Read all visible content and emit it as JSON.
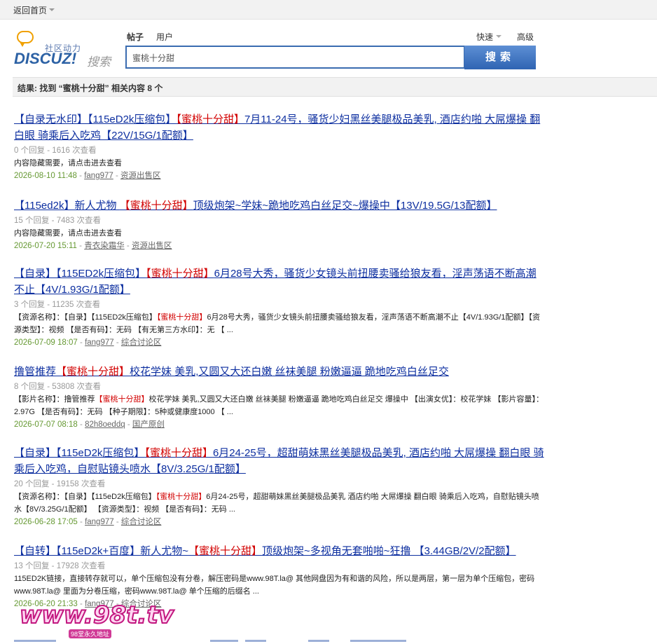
{
  "topbar": {
    "home_label": "返回首页"
  },
  "logo": {
    "slogan": "社区动力",
    "brand": "DISCUZ!",
    "search_word": "搜索"
  },
  "search": {
    "tab_posts": "帖子",
    "tab_users": "用户",
    "quick_label": "快速",
    "advanced_label": "高级",
    "query": "蜜桃十分甜",
    "button_label": "搜索"
  },
  "result_summary": "结果: 找到 “蜜桃十分甜” 相关内容 8 个",
  "results": [
    {
      "title_pre": "【自录无水印】【115eD2k压缩包】",
      "title_kw": "【蜜桃十分甜】",
      "title_post": "7月11-24号，骚货少妇黑丝美腿极品美乳, 酒店约啪 大屌爆操 翻白眼 骑乘后入吃鸡【22V/15G/1配额】",
      "meta": "0 个回复 - 1616 次查看",
      "body_pre": "内容隐藏需要，请点击进去查看",
      "body_kw": "",
      "body_post": "",
      "date": "2026-08-10 11:48",
      "author": "fang977",
      "forum": "资源出售区"
    },
    {
      "title_pre": "【115ed2k】新人尤物 ",
      "title_kw": "【蜜桃十分甜】",
      "title_post": "顶级炮架~学妹~跪地吃鸡白丝足交~爆操中【13V/19.5G/13配额】",
      "meta": "15 个回复 - 7483 次查看",
      "body_pre": "内容隐藏需要，请点击进去查看",
      "body_kw": "",
      "body_post": "",
      "date": "2026-07-20 15:11",
      "author": "青衣染霜华",
      "forum": "资源出售区"
    },
    {
      "title_pre": "【自录】【115ED2k压缩包】",
      "title_kw": "【蜜桃十分甜】",
      "title_post": "6月28号大秀，骚货少女镜头前扭腰卖骚给狼友看，淫声荡语不断高潮不止【4V/1.93G/1配额】",
      "meta": "3 个回复 - 11235 次查看",
      "body_pre": "【资源名称】：【自录】【115ED2k压缩包】",
      "body_kw": "【蜜桃十分甜】",
      "body_post": "6月28号大秀，骚货少女镜头前扭腰卖骚给狼友看，淫声荡语不断高潮不止【4V/1.93G/1配额】【资源类型】：视频 【是否有码】：无码 【有无第三方水印】：无 【 ...",
      "date": "2026-07-09 18:07",
      "author": "fang977",
      "forum": "综合讨论区"
    },
    {
      "title_pre": "撸管推荐",
      "title_kw": "【蜜桃十分甜】",
      "title_post": "校花学妹 美乳,又圆又大还白嫩 丝袜美腿 粉嫩逼逼 跪地吃鸡白丝足交",
      "meta": "8 个回复 - 53808 次查看",
      "body_pre": "【影片名称】：撸管推荐",
      "body_kw": "【蜜桃十分甜】",
      "body_post": "校花学妹 美乳,又圆又大还白嫩 丝袜美腿 粉嫩逼逼 跪地吃鸡白丝足交 爆操中 【出演女优】：校花学妹 【影片容量】：2.97G 【是否有码】：无码 【种子期限】：5种或健康度1000 【 ...",
      "date": "2026-07-07 08:18",
      "author": "82h8oeddq",
      "forum": "国产原创"
    },
    {
      "title_pre": "【自录】【115eD2k压缩包】",
      "title_kw": "【蜜桃十分甜】",
      "title_post": "6月24-25号，超甜萌妹黑丝美腿极品美乳, 酒店约啪 大屌爆操 翻白眼 骑乘后入吃鸡，自慰贴镜头喷水【8V/3.25G/1配额】",
      "meta": "20 个回复 - 19158 次查看",
      "body_pre": "【资源名称】：【自录】【115eD2k压缩包】",
      "body_kw": "【蜜桃十分甜】",
      "body_post": "6月24-25号，超甜萌妹黑丝美腿极品美乳 酒店约啪 大屌爆操 翻白眼 骑乘后入吃鸡，自慰贴镜头喷水【8V/3.25G/1配额】 【资源类型】：视频 【是否有码】：无码 ...",
      "date": "2026-06-28 17:05",
      "author": "fang977",
      "forum": "综合讨论区"
    },
    {
      "title_pre": "【自转】【115eD2k+百度】新人尤物~",
      "title_kw": "【蜜桃十分甜】",
      "title_post": "顶级炮架~多视角无套啪啪~狂撸 【3.44GB/2V/2配额】",
      "meta": "13 个回复 - 17928 次查看",
      "body_pre": "115ED2K链接，直接转存就可以，单个压缩包没有分卷，解压密码是www.98T.la@ 其他网盘因为有和谐的风险，所以是两层，第一层为单个压缩包，密码www.98T.la@ 里面为分卷压缩，密码www.98T.la@ 单个压缩的后缀名 ...",
      "body_kw": "",
      "body_post": "",
      "date": "2026-06-20 21:33",
      "author": "fang977",
      "forum": "综合讨论区"
    }
  ],
  "watermark": {
    "big": "www.98t.tv",
    "small": "98堂永久地址"
  }
}
